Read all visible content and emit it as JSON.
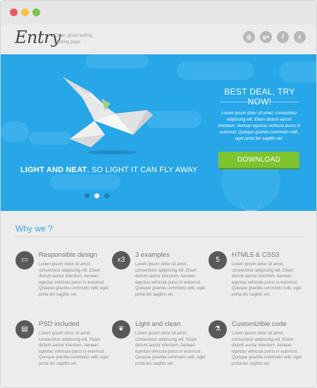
{
  "window": {
    "controls": [
      "close",
      "minimize",
      "maximize"
    ]
  },
  "header": {
    "logo": "Entry",
    "tagline_line1": "Clear, good selling,",
    "tagline_line2": "landing page",
    "social": [
      {
        "icon": "dribbble-icon",
        "glyph": "◎"
      },
      {
        "icon": "google-plus-icon",
        "glyph": "g+"
      },
      {
        "icon": "facebook-icon",
        "glyph": "f"
      },
      {
        "icon": "twitter-icon",
        "glyph": "t"
      }
    ]
  },
  "hero": {
    "tagline_bold": "LIGHT AND NEAT",
    "tagline_rest": ", SO LIGHT IT CAN FLY AWAY",
    "deal_title": "BEST DEAL, TRY NOW!",
    "deal_text": "Lorem ipsum dolor sit amet, consectetur adipiscing elit. Etiam dictum auctor interdum. Aenean egestas vehicula purus in euismod. Quisque gravida commodo velit, eget porta leo sagittis vel.",
    "download_label": "DOWNLOAD",
    "slider": {
      "count": 3,
      "active": 2
    },
    "colors": {
      "background": "#27a6e8",
      "button": "#7ec330"
    }
  },
  "why": {
    "title": "Why we ?",
    "features": [
      {
        "title": "Responsible design",
        "icon": "monitor-icon",
        "glyph": "▭",
        "text": "Lorem ipsum dolor sit amet, consectetur adipiscing elit. Etiam dictum auctor interdum. Aenean egestas vehicula purus in euismod. Quisque gravida commodo velit, eget porta leo sagittis vel."
      },
      {
        "title": "3 examples",
        "icon": "x3-icon",
        "glyph": "x3",
        "text": "Lorem ipsum dolor sit amet, consectetur adipiscing elit. Etiam dictum auctor interdum. Aenean egestas vehicula purus in euismod. Quisque gravida commodo velit, eget porta leo sagittis vel."
      },
      {
        "title": "HTML5 & CSS3",
        "icon": "html5-icon",
        "glyph": "5",
        "text": "Lorem ipsum dolor sit amet, consectetur adipiscing elit. Etiam dictum auctor interdum. Aenean egestas vehicula purus in euismod. Quisque gravida commodo velit, eget porta leo sagittis vel."
      },
      {
        "title": "PSD included",
        "icon": "document-icon",
        "glyph": "▤",
        "text": "Lorem ipsum dolor sit amet, consectetur adipiscing elit. Etiam dictum auctor interdum. Aenean egestas vehicula purus in euismod. Quisque gravida commodo velit, eget porta leo sagittis vel."
      },
      {
        "title": "Light and clean",
        "icon": "leaf-icon",
        "glyph": "❦",
        "text": "Lorem ipsum dolor sit amet, consectetur adipiscing elit. Etiam dictum auctor interdum. Aenean egestas vehicula purus in euismod. Quisque gravida commodo velit, eget porta leo sagittis vel."
      },
      {
        "title": "Customizible code",
        "icon": "flask-icon",
        "glyph": "⚗",
        "text": "Lorem ipsum dolor sit amet, consectetur adipiscing elit. Etiam dictum auctor interdum. Aenean egestas vehicula purus in euismod. Quisque gravida commodo velit, eget porta leo sagittis vel."
      }
    ],
    "accent": "#3aa4e0"
  }
}
